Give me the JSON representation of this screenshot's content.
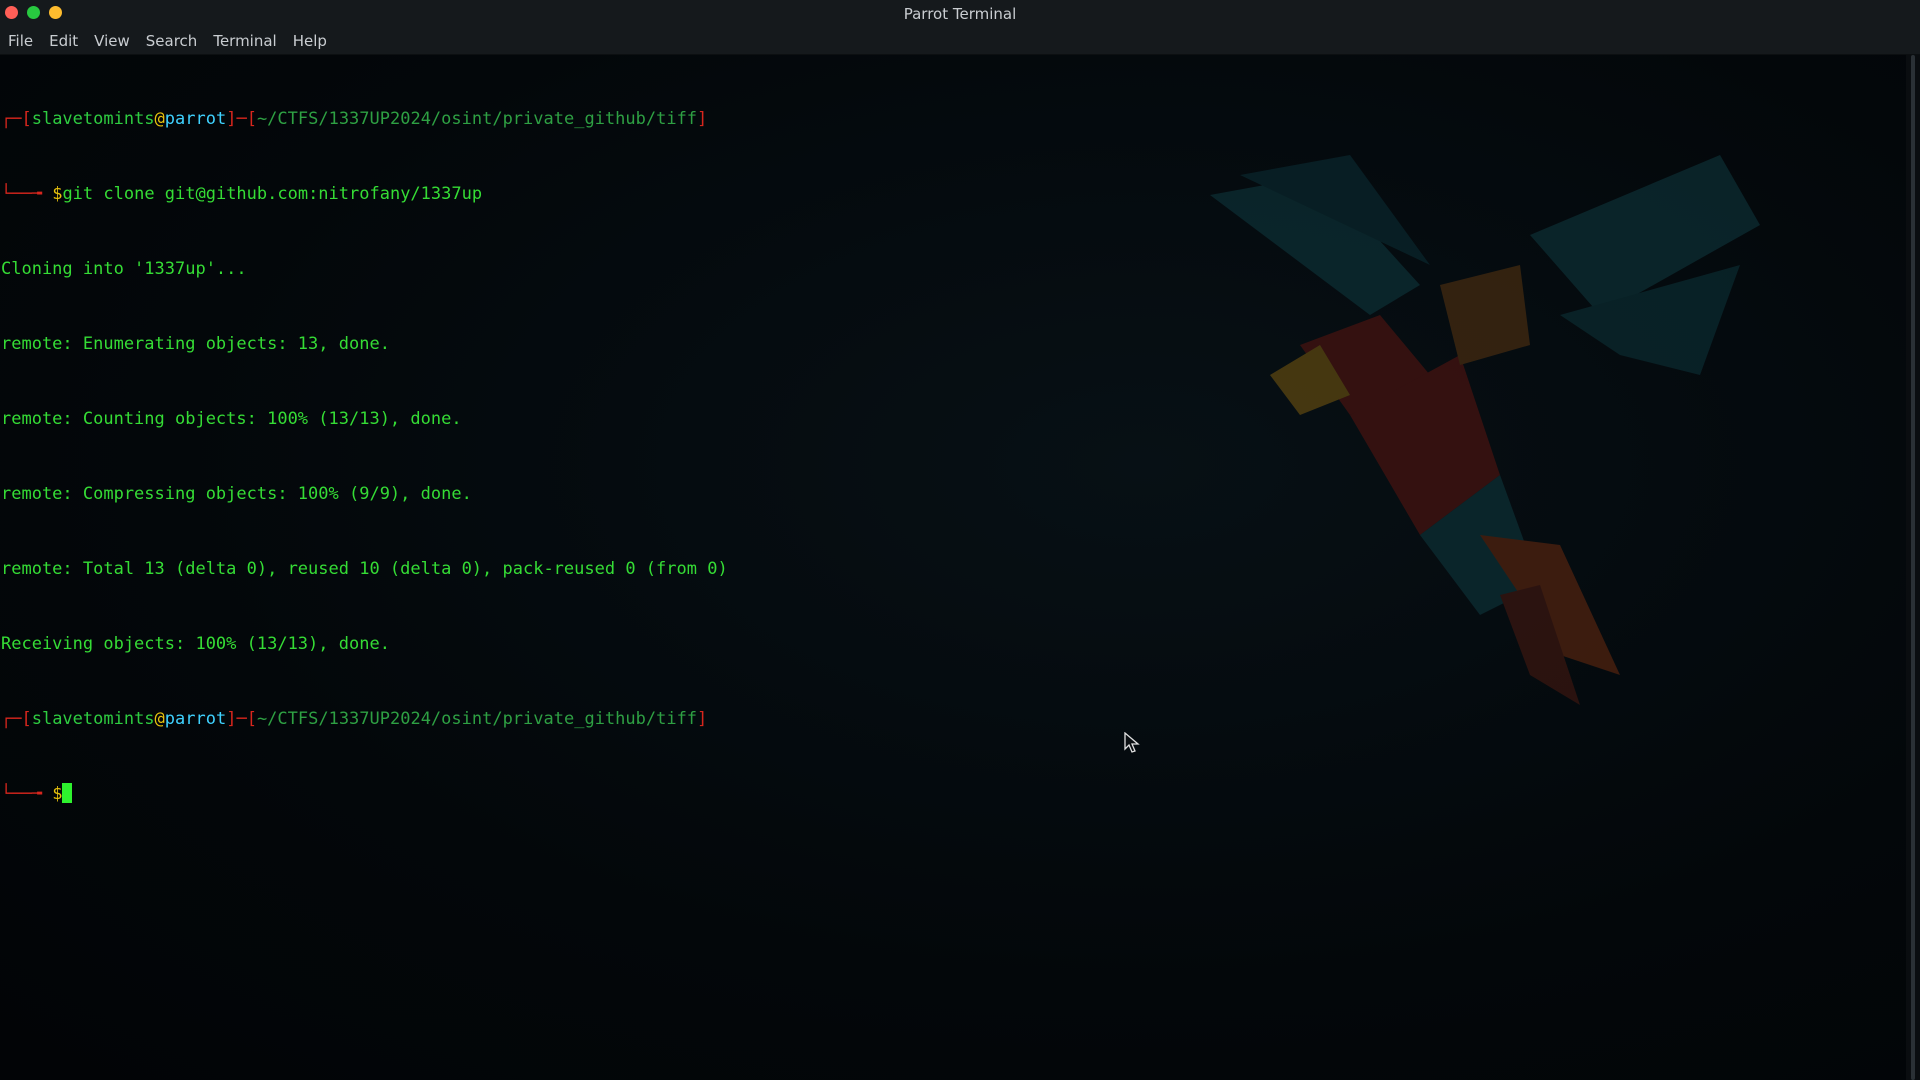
{
  "window": {
    "title": "Parrot Terminal"
  },
  "menubar": {
    "items": [
      "File",
      "Edit",
      "View",
      "Search",
      "Terminal",
      "Help"
    ]
  },
  "terminal": {
    "prompt1": {
      "user": "slavetomints",
      "at": "@",
      "host": "parrot",
      "path": "~/CTFS/1337UP2024/osint/private_github/tiff",
      "symbol": "$",
      "command": "git clone git@github.com:nitrofany/1337up"
    },
    "output": [
      "Cloning into '1337up'...",
      "remote: Enumerating objects: 13, done.",
      "remote: Counting objects: 100% (13/13), done.",
      "remote: Compressing objects: 100% (9/9), done.",
      "remote: Total 13 (delta 0), reused 10 (delta 0), pack-reused 0 (from 0)",
      "Receiving objects: 100% (13/13), done."
    ],
    "prompt2": {
      "user": "slavetomints",
      "at": "@",
      "host": "parrot",
      "path": "~/CTFS/1337UP2024/osint/private_github/tiff",
      "symbol": "$",
      "command": ""
    }
  },
  "colors": {
    "bracket": "#d7261d",
    "user": "#2ecc40",
    "at": "#e8c20d",
    "host": "#3fd2ff",
    "path": "#2ea043",
    "text": "#35dc35"
  }
}
